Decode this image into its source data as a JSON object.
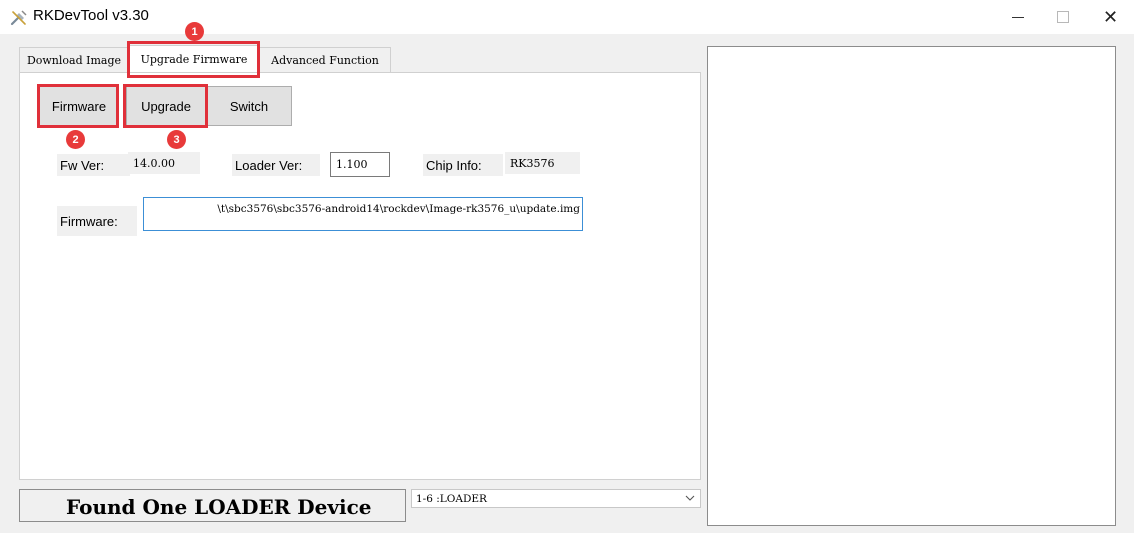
{
  "window": {
    "title": "RKDevTool v3.30",
    "icons": {
      "app": "rk-tool-icon",
      "minimize": "minimize-icon",
      "maximize": "maximize-icon",
      "close": "close-icon"
    },
    "close_glyph": "✕"
  },
  "tabs": [
    {
      "label": "Download Image",
      "active": false
    },
    {
      "label": "Upgrade Firmware",
      "active": true
    },
    {
      "label": "Advanced Function",
      "active": false
    }
  ],
  "buttons": {
    "firmware": "Firmware",
    "upgrade": "Upgrade",
    "switch": "Switch"
  },
  "info": {
    "fw_ver_label": "Fw Ver:",
    "fw_ver_value": "14.0.00",
    "loader_ver_label": "Loader Ver:",
    "loader_ver_value": "1.100",
    "chip_info_label": "Chip Info:",
    "chip_info_value": "RK3576",
    "firmware_label": "Firmware:",
    "firmware_path": "\\t\\sbc3576\\sbc3576-android14\\rockdev\\Image-rk3576_u\\update.img"
  },
  "annotations": {
    "badges": [
      "1",
      "2",
      "3"
    ],
    "highlight_color": "#e0303a"
  },
  "status": {
    "message": "Found One LOADER Device",
    "device_selected": "1-6 :LOADER"
  },
  "colors": {
    "window_bg": "#f0f0f0",
    "badge_bg": "#e83a3a",
    "focus_border": "#3c8fd6"
  }
}
